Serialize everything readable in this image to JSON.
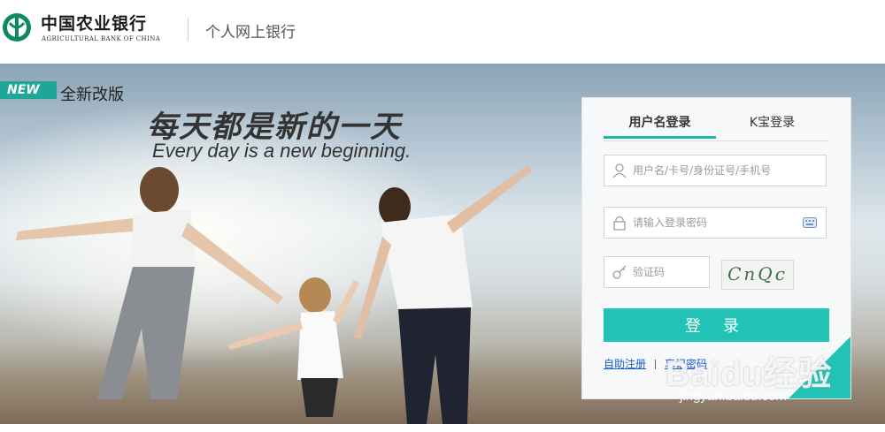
{
  "header": {
    "brand_cn": "中国农业银行",
    "brand_en": "AGRICULTURAL BANK OF CHINA",
    "product": "个人网上银行"
  },
  "banner": {
    "badge": "NEW",
    "badge_label": "全新改版",
    "slogan_cn": "每天都是新的一天",
    "slogan_en": "Every day is a new beginning."
  },
  "login": {
    "tabs": [
      {
        "label": "用户名登录",
        "active": true
      },
      {
        "label": "K宝登录",
        "active": false
      }
    ],
    "username_placeholder": "用户名/卡号/身份证号/手机号",
    "password_placeholder": "请输入登录密码",
    "captcha_placeholder": "验证码",
    "captcha_text": "CnQc",
    "login_button": "登 录",
    "link_register": "自助注册",
    "link_forgot": "忘记密码"
  },
  "watermark": {
    "text": "Baidu经验",
    "url": "jingyan.baidu.com"
  },
  "colors": {
    "accent": "#22c3b4",
    "brand_green": "#1a8a5a",
    "link": "#1e5bc6"
  }
}
